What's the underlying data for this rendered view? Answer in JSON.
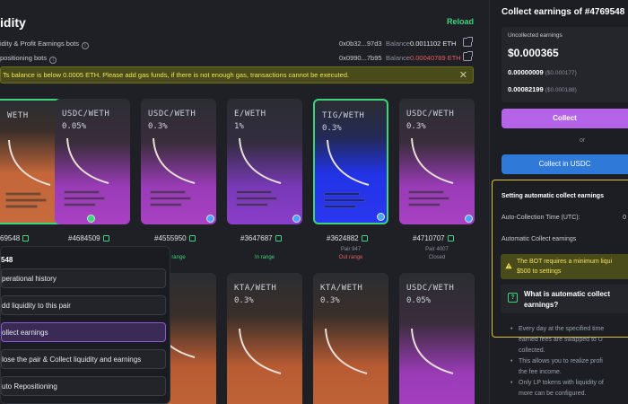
{
  "left": {
    "title": "idity",
    "reload": "Reload",
    "bots": [
      {
        "label": "idity & Profit Earnings bots",
        "address": "0x0b32...97d3",
        "balance_label": "Balance",
        "balance": "0.0011102 ETH",
        "balance_color": "#e6e8ec"
      },
      {
        "label": "positioning bots",
        "address": "0x0990...7b95",
        "balance_label": "Balance",
        "balance": "0.00040789 ETH",
        "balance_color": "#e85c5c"
      }
    ],
    "warning": "Ts balance is below 0.0005 ETH. Please add gas funds, if there is not enough gas, transactions cannot be executed.",
    "warning_close": "✕",
    "cards_row1": [
      {
        "pair": "WETH",
        "fee": "",
        "id": "69548",
        "status": ""
      },
      {
        "pair": "USDC/WETH",
        "fee": "0.05%",
        "id": "#4684509",
        "status": ""
      },
      {
        "pair": "USDC/WETH",
        "fee": "0.3%",
        "id": "#4555950",
        "status": "range"
      },
      {
        "pair": "E/WETH",
        "fee": "1%",
        "id": "#3647687",
        "status": "In range"
      },
      {
        "pair": "TIG/WETH",
        "fee": "0.3%",
        "id": "#3624882",
        "status_small": "Pair 947",
        "status": "Out range"
      },
      {
        "pair": "USDC/WETH",
        "fee": "0.3%",
        "id": "#4710707",
        "status_small": "Pair 4007",
        "status": "Closed"
      }
    ],
    "cards_row2": [
      {
        "pair": "KTA/WETH",
        "fee": "0.3%"
      },
      {
        "pair": "KTA/WETH",
        "fee": "0.3%"
      },
      {
        "pair": "USDC/WETH",
        "fee": "0.05%"
      }
    ],
    "menu": {
      "title": "548",
      "items": [
        "perational history",
        "dd liquidity to this pair",
        "ollect earnings",
        "lose the pair & Collect liquidity and earnings",
        "uto Repositioning"
      ]
    }
  },
  "right": {
    "title": "Collect earnings of #4769548",
    "uncollected_label": "Uncollected earnings",
    "total": "$0.000365",
    "row1_amount": "0.00000009",
    "row1_usd": "($0.000177)",
    "row2_amount": "0.00082199",
    "row2_usd": "($0.000188)",
    "collect_btn": "Collect",
    "or": "or",
    "collect_usdc_btn": "Collect in USDC",
    "settings_title": "Setting automatic collect earnings",
    "auto_time_label": "Auto-Collection Time (UTC):",
    "auto_time_value": "0",
    "auto_collect_label": "Automatic Collect earnings",
    "notice_line1": "The BOT requires a minimum liqui",
    "notice_line2": "$500 to settings",
    "faq_line1": "What is automatic collect",
    "faq_line2": "earnings?",
    "bullets": [
      "Every day at the specified time",
      "earned fees are swapped to U",
      "collected.",
      "This allows you to realize profi",
      "the fee income.",
      "Only LP tokens with liquidity of",
      "more can be configured."
    ]
  }
}
